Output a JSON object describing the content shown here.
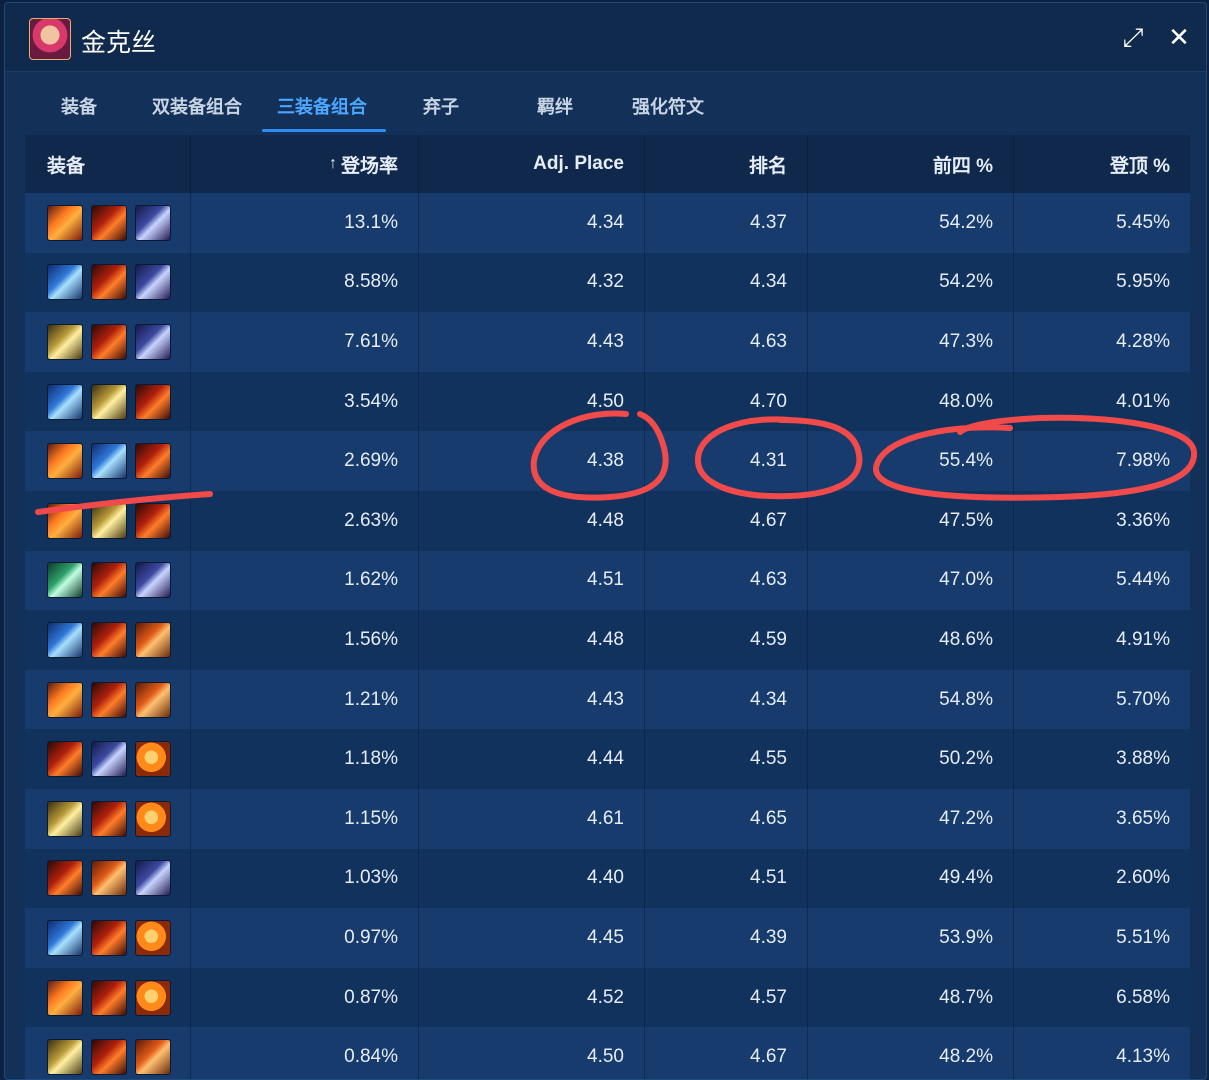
{
  "window": {
    "title": "金克丝",
    "expand_label": "⤢",
    "close_label": "✕"
  },
  "tabs": [
    {
      "label": "装备",
      "active": false
    },
    {
      "label": "双装备组合",
      "active": false
    },
    {
      "label": "三装备组合",
      "active": true
    },
    {
      "label": "弃子",
      "active": false
    },
    {
      "label": "羁绊",
      "active": false
    },
    {
      "label": "强化符文",
      "active": false
    }
  ],
  "table": {
    "columns": [
      "装备",
      "登场率",
      "Adj. Place",
      "排名",
      "前四 %",
      "登顶 %"
    ],
    "sort_arrow": "↑",
    "rows": [
      {
        "items": [
          "bloodfang-icon",
          "fire-icon",
          "sword-icon"
        ],
        "freq": "13.1%",
        "adj": "4.34",
        "rank": "4.37",
        "top4": "54.2%",
        "win": "5.45%"
      },
      {
        "items": [
          "blue-icon",
          "fire-icon",
          "sword-icon"
        ],
        "freq": "8.58%",
        "adj": "4.32",
        "rank": "4.34",
        "top4": "54.2%",
        "win": "5.95%"
      },
      {
        "items": [
          "gold-icon",
          "fire-icon",
          "sword-icon"
        ],
        "freq": "7.61%",
        "adj": "4.43",
        "rank": "4.63",
        "top4": "47.3%",
        "win": "4.28%"
      },
      {
        "items": [
          "blue-icon",
          "gold-icon",
          "fire-icon"
        ],
        "freq": "3.54%",
        "adj": "4.50",
        "rank": "4.70",
        "top4": "48.0%",
        "win": "4.01%"
      },
      {
        "items": [
          "bloodfang-icon",
          "blue-icon",
          "fire-icon"
        ],
        "freq": "2.69%",
        "adj": "4.38",
        "rank": "4.31",
        "top4": "55.4%",
        "win": "7.98%"
      },
      {
        "items": [
          "bloodfang-icon",
          "gold-icon",
          "fire-icon"
        ],
        "freq": "2.63%",
        "adj": "4.48",
        "rank": "4.67",
        "top4": "47.5%",
        "win": "3.36%"
      },
      {
        "items": [
          "green-icon",
          "fire-icon",
          "sword-icon"
        ],
        "freq": "1.62%",
        "adj": "4.51",
        "rank": "4.63",
        "top4": "47.0%",
        "win": "5.44%"
      },
      {
        "items": [
          "blue-icon",
          "fire-icon",
          "spear-icon"
        ],
        "freq": "1.56%",
        "adj": "4.48",
        "rank": "4.59",
        "top4": "48.6%",
        "win": "4.91%"
      },
      {
        "items": [
          "bloodfang-icon",
          "fire-icon",
          "spear-icon"
        ],
        "freq": "1.21%",
        "adj": "4.43",
        "rank": "4.34",
        "top4": "54.8%",
        "win": "5.70%"
      },
      {
        "items": [
          "fire-icon",
          "sword-icon",
          "orange-icon"
        ],
        "freq": "1.18%",
        "adj": "4.44",
        "rank": "4.55",
        "top4": "50.2%",
        "win": "3.88%"
      },
      {
        "items": [
          "gold-icon",
          "fire-icon",
          "orange-icon"
        ],
        "freq": "1.15%",
        "adj": "4.61",
        "rank": "4.65",
        "top4": "47.2%",
        "win": "3.65%"
      },
      {
        "items": [
          "fire-icon",
          "spear-icon",
          "sword-icon"
        ],
        "freq": "1.03%",
        "adj": "4.40",
        "rank": "4.51",
        "top4": "49.4%",
        "win": "2.60%"
      },
      {
        "items": [
          "blue-icon",
          "fire-icon",
          "orange-icon"
        ],
        "freq": "0.97%",
        "adj": "4.45",
        "rank": "4.39",
        "top4": "53.9%",
        "win": "5.51%"
      },
      {
        "items": [
          "bloodfang-icon",
          "fire-icon",
          "orange-icon"
        ],
        "freq": "0.87%",
        "adj": "4.52",
        "rank": "4.57",
        "top4": "48.7%",
        "win": "6.58%"
      },
      {
        "items": [
          "gold-icon",
          "fire-icon",
          "spear-icon"
        ],
        "freq": "0.84%",
        "adj": "4.50",
        "rank": "4.67",
        "top4": "48.2%",
        "win": "4.13%"
      }
    ]
  },
  "colors": {
    "accent": "#2f8cf0",
    "annotation": "#f04a4a"
  }
}
